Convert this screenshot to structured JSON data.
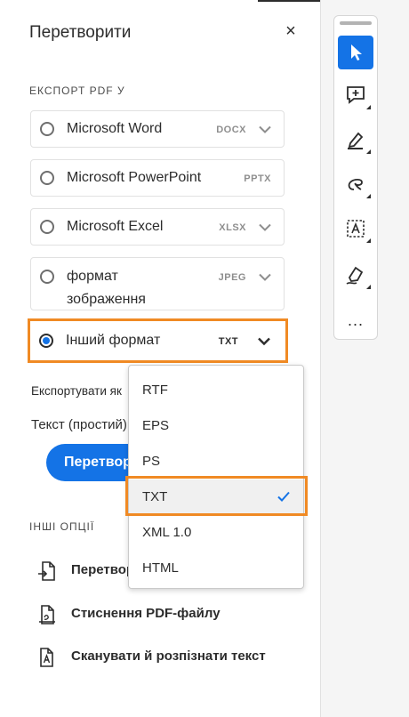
{
  "panel": {
    "title": "Перетворити",
    "close_label": "×",
    "export_section": "ЕКСПОРТ PDF У",
    "options": [
      {
        "label": "Microsoft Word",
        "ext": "DOCX",
        "selected": false
      },
      {
        "label": "Microsoft PowerPoint",
        "ext": "PPTX",
        "selected": false
      },
      {
        "label": "Microsoft Excel",
        "ext": "XLSX",
        "selected": false
      },
      {
        "label_line1": "формат",
        "label_line2": "зображення",
        "ext": "JPEG",
        "selected": false
      },
      {
        "label": "Інший формат",
        "ext": "TXT",
        "selected": true
      }
    ],
    "export_as_label": "Експортувати як",
    "export_as_value": "Текст (простий)",
    "convert_button": "Перетворити",
    "other_options_section": "ІНШІ ОПЦІЇ",
    "tools": [
      {
        "label": "Перетворити",
        "icon": "convert-file-icon"
      },
      {
        "label": "Стиснення PDF-файлу",
        "icon": "compress-pdf-icon"
      },
      {
        "label": "Сканувати й розпізнати текст",
        "icon": "scan-ocr-icon"
      }
    ]
  },
  "dropdown": {
    "items": [
      "RTF",
      "EPS",
      "PS",
      "TXT",
      "XML 1.0",
      "HTML"
    ],
    "selected": "TXT"
  },
  "toolbar": {
    "tools": [
      "select-arrow-icon",
      "add-comment-icon",
      "highlight-pen-icon",
      "draw-freehand-icon",
      "text-select-icon",
      "sign-pen-icon"
    ],
    "more_label": "..."
  },
  "colors": {
    "accent": "#1473e6",
    "highlight": "#f08a24",
    "border": "#e1e1e1"
  }
}
